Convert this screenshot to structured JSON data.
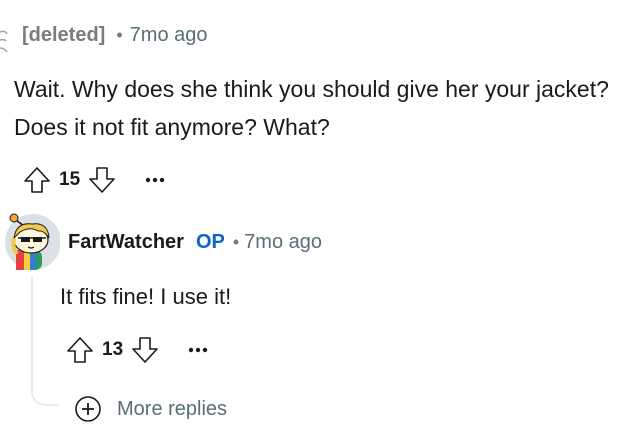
{
  "parent_comment": {
    "author": "[deleted]",
    "separator": "•",
    "age": "7mo ago",
    "body": "Wait. Why does she think you should give her your jacket? Does it not fit anymore? What?",
    "score": "15",
    "upvote_icon": "arrow-up-outline-icon",
    "downvote_icon": "arrow-down-outline-icon",
    "more_icon": "ellipsis-icon"
  },
  "reply": {
    "author": "FartWatcher",
    "badge": "OP",
    "separator": "•",
    "age": "7mo ago",
    "body": "It fits fine! I use it!",
    "score": "13",
    "avatar_icon": "snoo-avatar-icon"
  },
  "more_replies": {
    "label": "More replies",
    "icon": "plus-circle-icon"
  },
  "colors": {
    "accent_op": "#0a66c8",
    "muted_text": "#576f76",
    "thread_line": "#e5ebee"
  }
}
